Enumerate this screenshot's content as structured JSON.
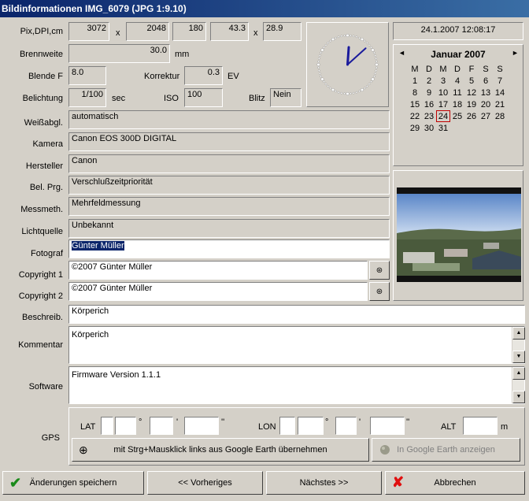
{
  "window": {
    "title": "Bildinformationen  IMG_6079  (JPG 1:9.10)"
  },
  "labels": {
    "pix": "Pix,DPI,cm",
    "x1": "x",
    "x2": "x",
    "brennweite": "Brennweite",
    "mm": "mm",
    "blende": "Blende  F",
    "korrektur": "Korrektur",
    "ev": "EV",
    "belichtung": "Belichtung",
    "sec": "sec",
    "iso": "ISO",
    "blitz": "Blitz",
    "weissabgl": "Weißabgl.",
    "kamera": "Kamera",
    "hersteller": "Hersteller",
    "belprg": "Bel. Prg.",
    "messmeth": "Messmeth.",
    "lichtquelle": "Lichtquelle",
    "fotograf": "Fotograf",
    "copyright1": "Copyright 1",
    "copyright2": "Copyright 2",
    "beschreib": "Beschreib.",
    "kommentar": "Kommentar",
    "software": "Software",
    "gps": "GPS"
  },
  "values": {
    "width": "3072",
    "height": "2048",
    "dpi": "180",
    "cm_w": "43.3",
    "cm_h": "28.9",
    "brennweite": "30.0",
    "blende": "8.0",
    "korrektur": "0.3",
    "belichtung": "1/100",
    "iso": "100",
    "blitz": "Nein",
    "weissabgl": "automatisch",
    "kamera": "Canon EOS 300D DIGITAL",
    "hersteller": "Canon",
    "belprg": "Verschlußzeitpriorität",
    "messmeth": "Mehrfeldmessung",
    "lichtquelle": "Unbekannt",
    "fotograf": "Günter Müller",
    "copyright1": "©2007 Günter Müller",
    "copyright2": "©2007 Günter Müller",
    "beschreib": "Körperich",
    "kommentar": "Körperich",
    "software": "Firmware Version 1.1.1"
  },
  "datetime": "24.1.2007 12:08:17",
  "clock": {
    "hour": 12,
    "minute": 8
  },
  "calendar": {
    "month_label": "Januar 2007",
    "prev": "◄",
    "next": "►",
    "weekdays": [
      "M",
      "D",
      "M",
      "D",
      "F",
      "S",
      "S"
    ],
    "weeks": [
      [
        "1",
        "2",
        "3",
        "4",
        "5",
        "6",
        "7"
      ],
      [
        "8",
        "9",
        "10",
        "11",
        "12",
        "13",
        "14"
      ],
      [
        "15",
        "16",
        "17",
        "18",
        "19",
        "20",
        "21"
      ],
      [
        "22",
        "23",
        "24",
        "25",
        "26",
        "27",
        "28"
      ],
      [
        "29",
        "30",
        "31",
        "",
        "",
        "",
        ""
      ]
    ],
    "today": "24"
  },
  "gps": {
    "lat": "LAT",
    "lon": "LON",
    "alt": "ALT",
    "deg": "°",
    "min": "'",
    "sec": "''",
    "m": "m",
    "btn_take": "mit Strg+Mausklick links aus Google Earth übernehmen",
    "btn_show": "In Google Earth anzeigen"
  },
  "buttons": {
    "save": "Änderungen speichern",
    "prev": "<< Vorheriges",
    "next": "Nächstes >>",
    "cancel": "Abbrechen"
  },
  "colors": {
    "title_start": "#0a246a",
    "title_end": "#3a6ea5",
    "save_check": "#1a8a1a",
    "cancel_x": "#e01010",
    "clock_hand": "#1a1a9c"
  }
}
